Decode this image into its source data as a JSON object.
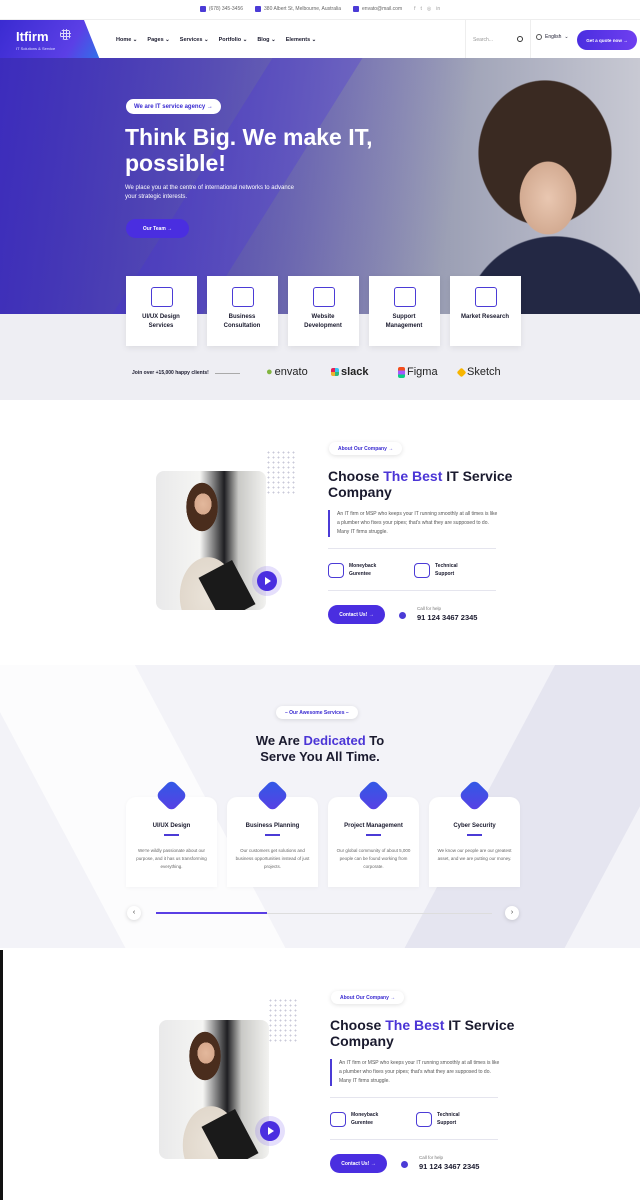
{
  "topbar": {
    "phone": "(678) 345-3456",
    "address": "380 Albert St, Melbourne, Australia",
    "email": "envato@mail.com",
    "social": [
      "f",
      "t",
      "◎",
      "in"
    ]
  },
  "nav": {
    "logo": "Itfirm",
    "logo_tag": "IT Solutions & Service",
    "menu": [
      "Home",
      "Pages",
      "Services",
      "Portfolio",
      "Blog",
      "Elements"
    ],
    "active": "Home",
    "search_placeholder": "Search...",
    "language": "English",
    "quote_button": "Get a quote now"
  },
  "hero": {
    "badge": "We are IT service agency",
    "title": "Think Big. We make IT, possible!",
    "subtitle": "We place you at the centre of international networks to advance your strategic interests.",
    "button": "Our Team"
  },
  "service_strip": [
    {
      "label": "UI/UX Design Services",
      "icon": "design-icon"
    },
    {
      "label": "Business Consultation",
      "icon": "consultation-icon"
    },
    {
      "label": "Website Development",
      "icon": "code-icon"
    },
    {
      "label": "Support Management",
      "icon": "support-icon"
    },
    {
      "label": "Market Research",
      "icon": "research-icon"
    }
  ],
  "clients": {
    "text": "Join over +15,000 happy clients!",
    "brands": [
      "envato",
      "slack",
      "Figma",
      "Sketch"
    ]
  },
  "about": {
    "badge": "About Our Company",
    "title_pre": "Choose ",
    "title_hl": "The Best",
    "title_post": " IT Service Company",
    "para": "An IT firm or MSP who keeps your IT running smoothly at all times is like a plumber who fixes your pipes; that's what they are supposed to do. Many IT firms struggle.",
    "feat1": "Moneyback Gurentee",
    "feat2": "Technical Support",
    "button": "Contact Us!",
    "call_label": "Call for help",
    "phone": "91 124 3467 2345"
  },
  "services": {
    "badge": "Our Awesome Services",
    "title_pre": "We Are ",
    "title_hl": "Dedicated",
    "title_post": " To",
    "title_line2": "Serve You All Time.",
    "cards": [
      {
        "title": "UI/UX Design",
        "text": "We're wildly passionate about our purpose, and it has us transforming everything."
      },
      {
        "title": "Business Planning",
        "text": "Our customers get solutions and business opportunities instead of just projects."
      },
      {
        "title": "Project Management",
        "text": "Our global community of about 5,000 people can be found working from corporate."
      },
      {
        "title": "Cyber Security",
        "text": "We know our people are our greatest asset, and we are putting our money."
      }
    ],
    "progress": 0.33
  },
  "colors": {
    "accent": "#4b35d6",
    "button": "#4a2ee0"
  }
}
